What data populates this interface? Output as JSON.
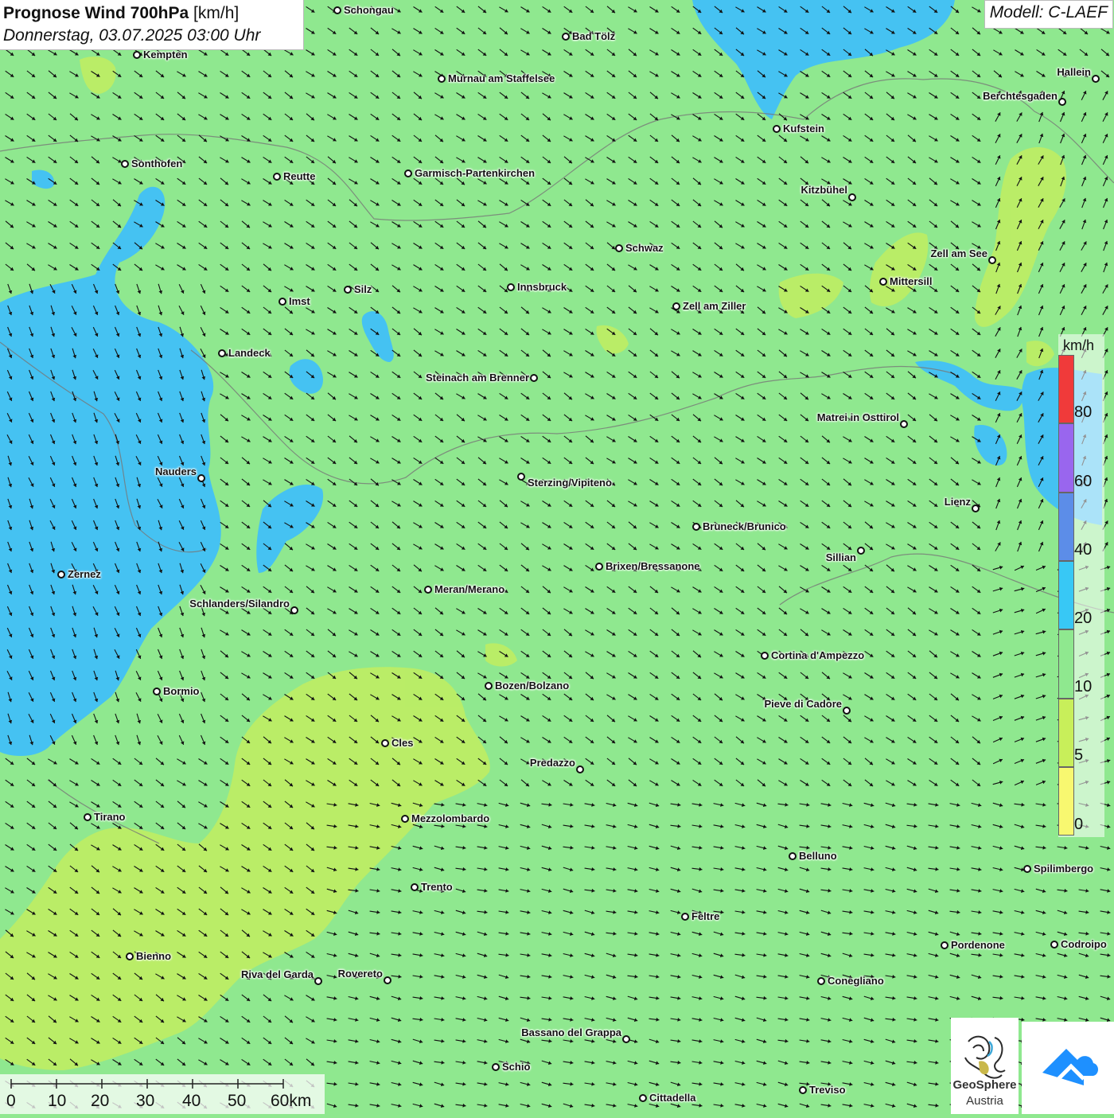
{
  "header": {
    "title_bold": "Prognose Wind 700hPa",
    "title_unit": "[km/h]",
    "datetime": "Donnerstag, 03.07.2025 03:00 Uhr"
  },
  "model": "Modell: C-LAEF",
  "legend": {
    "unit": "km/h",
    "labels": [
      "80",
      "60",
      "40",
      "20",
      "10",
      "5",
      "0"
    ],
    "colors": [
      "#f03a3a",
      "#9966ee",
      "#5c8de8",
      "#38c8f5",
      "#8fe88f",
      "#c8ef5a",
      "#f8f870"
    ]
  },
  "scale_bar": {
    "labels": [
      "0",
      "10",
      "20",
      "30",
      "40",
      "50",
      "60km"
    ]
  },
  "logo": {
    "name_line1": "GeoSphere",
    "name_line2": "Austria"
  },
  "cities": [
    {
      "name": "Schongau"
    },
    {
      "name": "Bad Tölz"
    },
    {
      "name": "Kempten"
    },
    {
      "name": "Murnau am Staffelsee"
    },
    {
      "name": "Hallein"
    },
    {
      "name": "Berchtesgaden"
    },
    {
      "name": "Kufstein"
    },
    {
      "name": "Sonthofen"
    },
    {
      "name": "Reutte"
    },
    {
      "name": "Garmisch-Partenkirchen"
    },
    {
      "name": "Kitzbühel"
    },
    {
      "name": "Schwaz"
    },
    {
      "name": "Zell am See"
    },
    {
      "name": "Mittersill"
    },
    {
      "name": "Innsbruck"
    },
    {
      "name": "Imst"
    },
    {
      "name": "Silz"
    },
    {
      "name": "Zell am Ziller"
    },
    {
      "name": "Landeck"
    },
    {
      "name": "Steinach am Brenner"
    },
    {
      "name": "Matrei in Osttirol"
    },
    {
      "name": "Nauders"
    },
    {
      "name": "Sterzing/Vipiteno"
    },
    {
      "name": "Lienz"
    },
    {
      "name": "Bruneck/Brunico"
    },
    {
      "name": "Sillian"
    },
    {
      "name": "Brixen/Bressanone"
    },
    {
      "name": "Zernez"
    },
    {
      "name": "Meran/Merano"
    },
    {
      "name": "Schlanders/Silandro"
    },
    {
      "name": "Cortina d'Ampezzo"
    },
    {
      "name": "Bozen/Bolzano"
    },
    {
      "name": "Bormio"
    },
    {
      "name": "Pieve di Cadore"
    },
    {
      "name": "Cles"
    },
    {
      "name": "Predazzo"
    },
    {
      "name": "Tirano"
    },
    {
      "name": "Mezzolombardo"
    },
    {
      "name": "Belluno"
    },
    {
      "name": "Spilimbergo"
    },
    {
      "name": "Trento"
    },
    {
      "name": "Feltre"
    },
    {
      "name": "Pordenone"
    },
    {
      "name": "Codroipo"
    },
    {
      "name": "Bienno"
    },
    {
      "name": "Riva del Garda"
    },
    {
      "name": "Rovereto"
    },
    {
      "name": "Conegliano"
    },
    {
      "name": "Bassano del Grappa"
    },
    {
      "name": "Schio"
    },
    {
      "name": "Treviso"
    },
    {
      "name": "Cittadella"
    }
  ]
}
